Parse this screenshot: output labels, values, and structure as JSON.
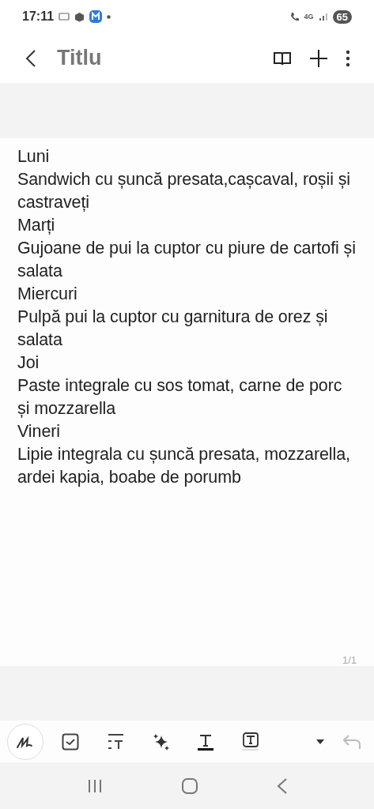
{
  "status_bar": {
    "time": "17:11",
    "network": "4G",
    "battery": "65"
  },
  "header": {
    "title": "Titlu"
  },
  "note": {
    "paragraphs": [
      "Luni",
      "Sandwich cu șuncă presata,cașcaval, roșii și castraveți",
      "Marți",
      "Gujoane de pui la cuptor cu piure de cartofi și salata",
      "Miercuri",
      "Pulpă pui la cuptor cu garnitura de orez și salata",
      "Joi",
      "Paste integrale cu sos tomat, carne de porc și mozzarella",
      "Vineri",
      "Lipie integrala cu șuncă presata, mozzarella, ardei kapia, boabe de porumb"
    ],
    "page": "1/1"
  },
  "toolbar": {
    "tools": [
      {
        "kind": "pen",
        "selected": true
      },
      {
        "kind": "checkbox",
        "selected": false
      },
      {
        "kind": "text-style",
        "selected": false
      },
      {
        "kind": "sparkle",
        "selected": false
      },
      {
        "kind": "text-color",
        "selected": false
      },
      {
        "kind": "text-highlight",
        "selected": false
      }
    ],
    "undo": {
      "disabled": true
    }
  }
}
